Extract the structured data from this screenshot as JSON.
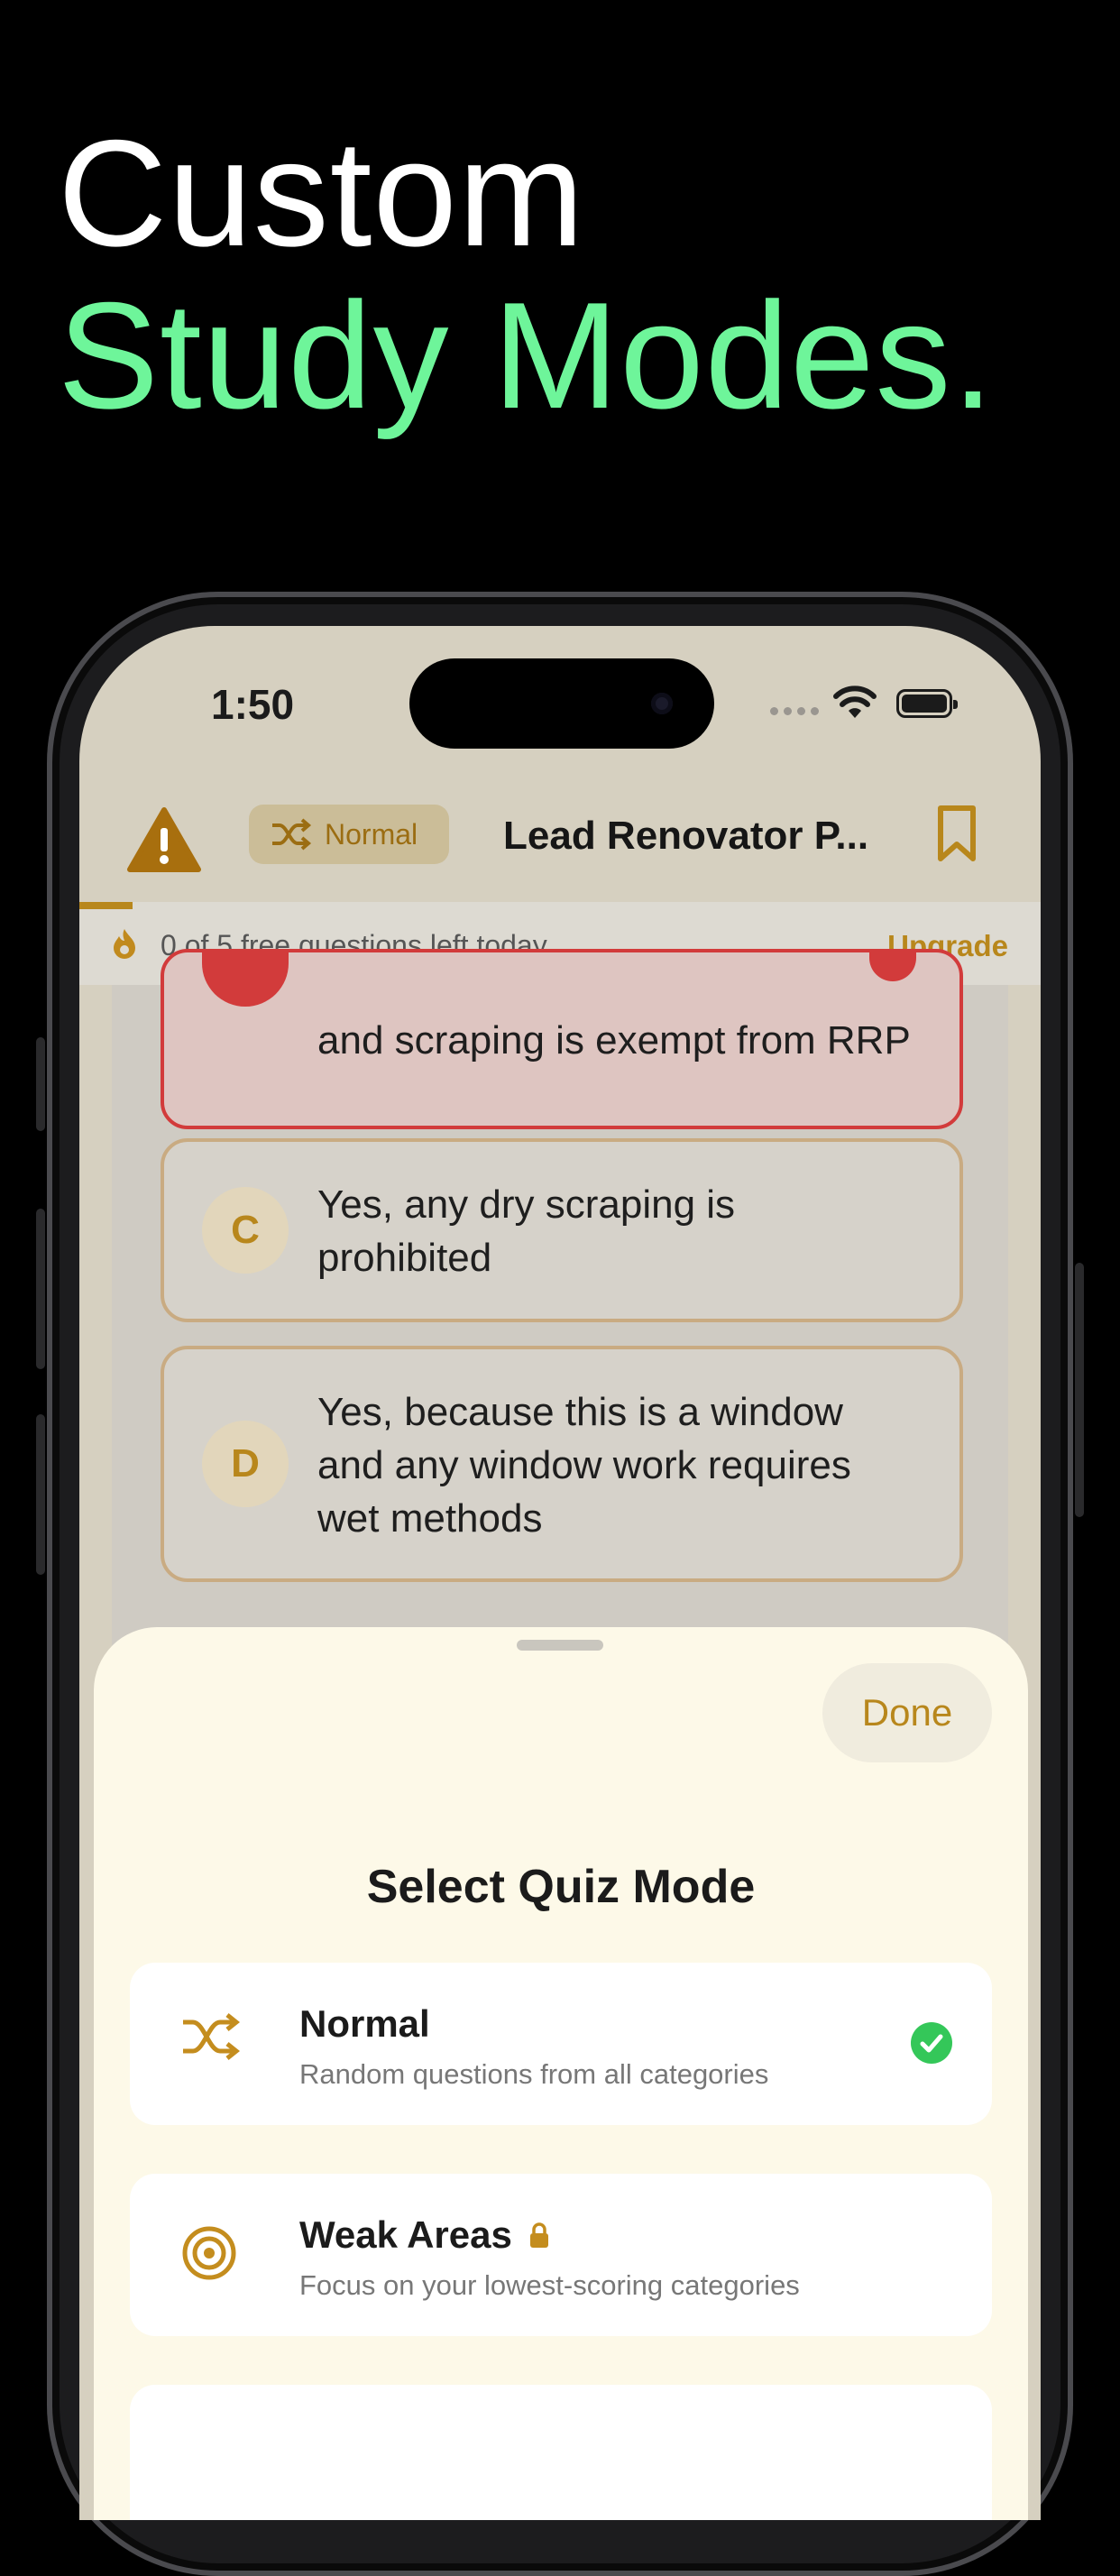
{
  "headline": {
    "line1": "Custom",
    "line2": "Study Modes."
  },
  "status": {
    "time": "1:50"
  },
  "topbar": {
    "mode_label": "Normal",
    "title": "Lead Renovator P..."
  },
  "free_bar": {
    "text": "0 of 5 free questions left today",
    "upgrade": "Upgrade",
    "progress_fraction": 0.055
  },
  "options": [
    {
      "text": "and scraping is exempt from RRP",
      "state": "wrong"
    },
    {
      "letter": "C",
      "text": "Yes, any dry scraping is prohibited"
    },
    {
      "letter": "D",
      "text": "Yes, because this is a window and any window work requires wet methods"
    }
  ],
  "sheet": {
    "done": "Done",
    "title": "Select Quiz Mode",
    "modes": [
      {
        "name": "Normal",
        "description": "Random questions from all categories",
        "icon": "shuffle-icon",
        "selected": true,
        "locked": false
      },
      {
        "name": "Weak Areas",
        "description": "Focus on your lowest-scoring categories",
        "icon": "target-icon",
        "selected": false,
        "locked": true
      }
    ]
  },
  "colors": {
    "accent": "#b8871c",
    "headline_green": "#6ef59a",
    "error": "#d23b3b",
    "success": "#34c759"
  }
}
